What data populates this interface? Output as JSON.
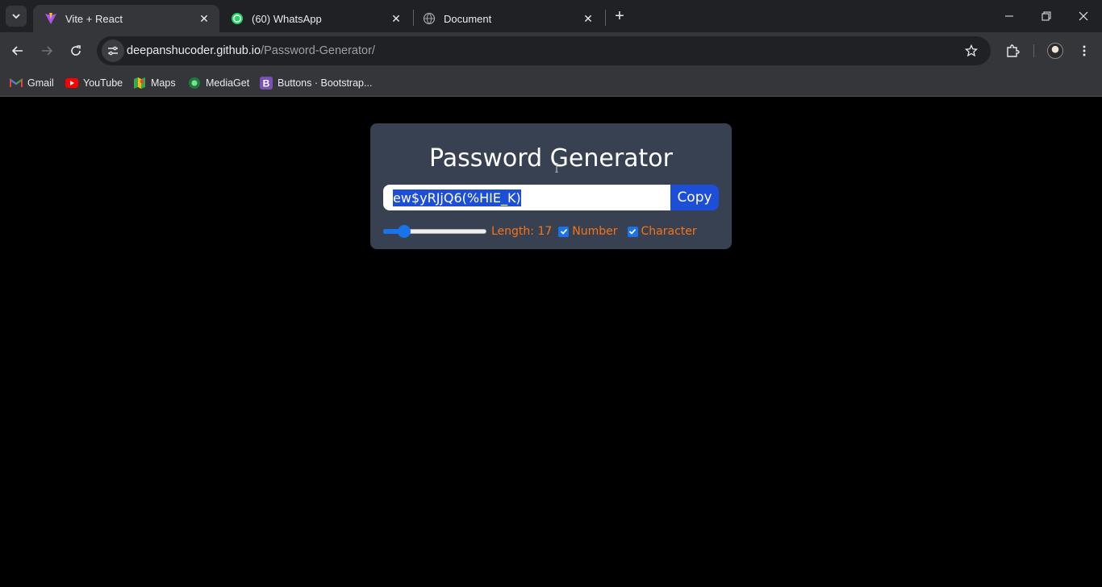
{
  "browser": {
    "tabs": [
      {
        "title": "Vite + React",
        "icon": "vite-icon",
        "active": true
      },
      {
        "title": "(60) WhatsApp",
        "icon": "whatsapp-icon",
        "active": false
      },
      {
        "title": "Document",
        "icon": "globe-icon",
        "active": false
      }
    ],
    "url": {
      "host": "deepanshucoder.github.io",
      "path": "/Password-Generator/"
    },
    "bookmarks": [
      {
        "label": "Gmail",
        "icon": "gmail-icon"
      },
      {
        "label": "YouTube",
        "icon": "youtube-icon"
      },
      {
        "label": "Maps",
        "icon": "maps-icon"
      },
      {
        "label": "MediaGet",
        "icon": "mediaget-icon"
      },
      {
        "label": "Buttons · Bootstrap...",
        "icon": "bootstrap-icon"
      }
    ]
  },
  "app": {
    "title": "Password Generator",
    "password": "ew$yRJjQ6(%HIE_K)",
    "copy_label": "Copy",
    "length_label": "Length: 17",
    "length_value": 17,
    "length_fraction": 0.16,
    "number_label": "Number",
    "number_checked": true,
    "character_label": "Character",
    "character_checked": true
  },
  "colors": {
    "card_bg": "#374151",
    "accent": "#1d4ed8",
    "option_text": "#f97316"
  }
}
